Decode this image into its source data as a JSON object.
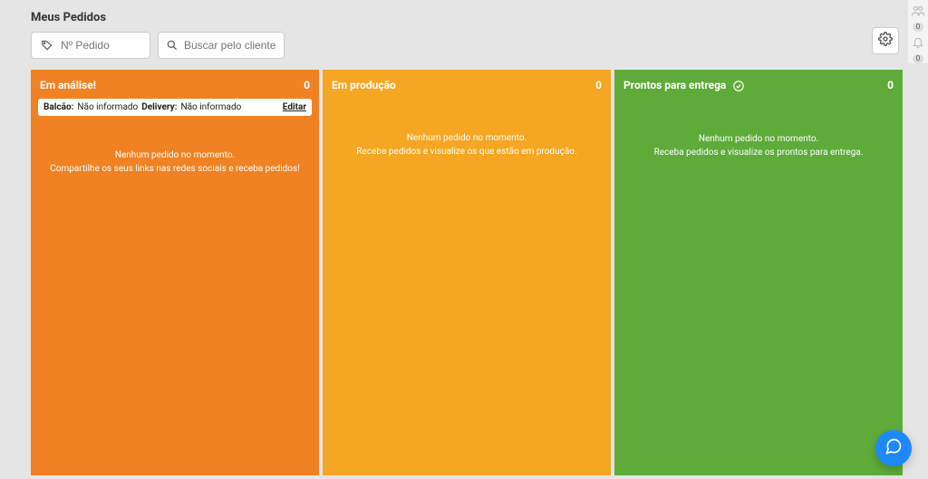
{
  "page_title": "Meus Pedidos",
  "search": {
    "pedido_placeholder": "Nº Pedido",
    "cliente_placeholder": "Buscar pelo cliente"
  },
  "rail": {
    "people_badge": "0",
    "bell_badge": "0"
  },
  "columns": [
    {
      "title": "Em análise!",
      "count": "0",
      "filter": {
        "balcao_label": "Balcão:",
        "balcao_value": "Não informado",
        "delivery_label": "Delivery:",
        "delivery_value": "Não informado",
        "edit": "Editar"
      },
      "empty_line1": "Nenhum pedido no momento.",
      "empty_line2": "Compartilhe os seus links nas redes sociais e receba pedidos!"
    },
    {
      "title": "Em produção",
      "count": "0",
      "empty_line1": "Nenhum pedido no momento.",
      "empty_line2": "Receba pedidos e visualize os que estão em produção."
    },
    {
      "title": "Prontos para entrega",
      "count": "0",
      "empty_line1": "Nenhum pedido no momento.",
      "empty_line2": "Receba pedidos e visualize os prontos para entrega."
    }
  ]
}
